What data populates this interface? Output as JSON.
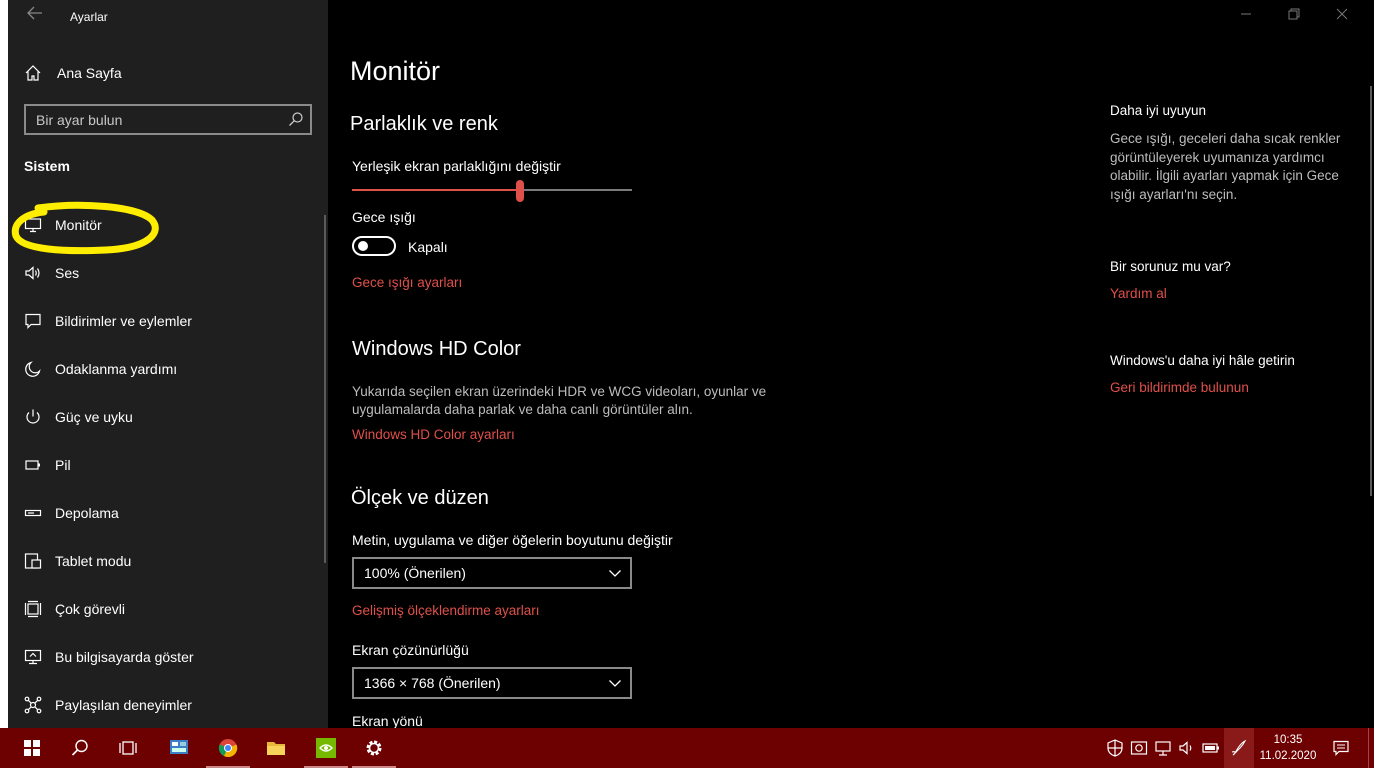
{
  "window": {
    "title": "Ayarlar"
  },
  "sidebar": {
    "home_label": "Ana Sayfa",
    "search_placeholder": "Bir ayar bulun",
    "section": "Sistem",
    "items": [
      {
        "label": "Monitör",
        "icon": "monitor-icon"
      },
      {
        "label": "Ses",
        "icon": "speaker-icon"
      },
      {
        "label": "Bildirimler ve eylemler",
        "icon": "notification-icon"
      },
      {
        "label": "Odaklanma yardımı",
        "icon": "moon-icon"
      },
      {
        "label": "Güç ve uyku",
        "icon": "power-icon"
      },
      {
        "label": "Pil",
        "icon": "battery-icon"
      },
      {
        "label": "Depolama",
        "icon": "storage-icon"
      },
      {
        "label": "Tablet modu",
        "icon": "tablet-icon"
      },
      {
        "label": "Çok görevli",
        "icon": "multitasking-icon"
      },
      {
        "label": "Bu bilgisayarda göster",
        "icon": "project-icon"
      },
      {
        "label": "Paylaşılan deneyimler",
        "icon": "shared-icon"
      }
    ]
  },
  "main": {
    "title": "Monitör",
    "brightness": {
      "heading": "Parlaklık ve renk",
      "label": "Yerleşik ekran parlaklığını değiştir",
      "value_fraction": 0.6
    },
    "night_light": {
      "label": "Gece ışığı",
      "state": "Kapalı",
      "settings_link": "Gece ışığı ayarları"
    },
    "hd_color": {
      "heading": "Windows HD Color",
      "desc_line1": "Yukarıda seçilen ekran üzerindeki HDR ve WCG videoları, oyunlar ve",
      "desc_line2": "uygulamalarda daha parlak ve daha canlı görüntüler alın.",
      "link": "Windows HD Color ayarları"
    },
    "scale": {
      "heading": "Ölçek ve düzen",
      "size_label": "Metin, uygulama ve diğer öğelerin boyutunu değiştir",
      "size_value": "100% (Önerilen)",
      "advanced_link": "Gelişmiş ölçeklendirme ayarları",
      "resolution_label": "Ekran çözünürlüğü",
      "resolution_value": "1366 × 768 (Önerilen)",
      "orientation_label": "Ekran yönü"
    }
  },
  "aside": {
    "sleep_heading": "Daha iyi uyuyun",
    "sleep_l1": "Gece ışığı, geceleri daha sıcak renkler",
    "sleep_l2": "görüntüleyerek uyumanıza yardımcı",
    "sleep_l3": "olabilir. İlgili ayarları yapmak için Gece",
    "sleep_l4": "ışığı ayarları'nı seçin.",
    "question_heading": "Bir sorunuz mu var?",
    "help_link": "Yardım al",
    "improve_heading": "Windows'u daha iyi hâle getirin",
    "feedback_link": "Geri bildirimde bulunun"
  },
  "taskbar": {
    "time": "10:35",
    "date": "11.02.2020"
  },
  "colors": {
    "accent": "#e0504a",
    "taskbar": "#6d0000",
    "sidebar": "#1f1f1f",
    "highlight": "#ffee00"
  }
}
